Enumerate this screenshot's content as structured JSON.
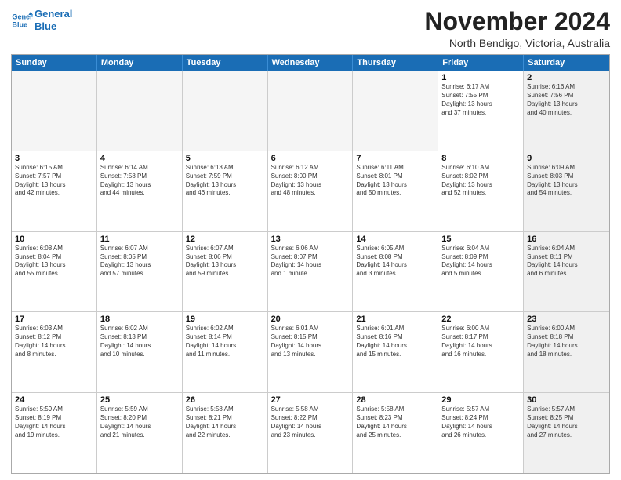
{
  "logo": {
    "line1": "General",
    "line2": "Blue"
  },
  "title": "November 2024",
  "location": "North Bendigo, Victoria, Australia",
  "header_days": [
    "Sunday",
    "Monday",
    "Tuesday",
    "Wednesday",
    "Thursday",
    "Friday",
    "Saturday"
  ],
  "rows": [
    [
      {
        "day": "",
        "text": "",
        "empty": true
      },
      {
        "day": "",
        "text": "",
        "empty": true
      },
      {
        "day": "",
        "text": "",
        "empty": true
      },
      {
        "day": "",
        "text": "",
        "empty": true
      },
      {
        "day": "",
        "text": "",
        "empty": true
      },
      {
        "day": "1",
        "text": "Sunrise: 6:17 AM\nSunset: 7:55 PM\nDaylight: 13 hours\nand 37 minutes.",
        "shaded": false
      },
      {
        "day": "2",
        "text": "Sunrise: 6:16 AM\nSunset: 7:56 PM\nDaylight: 13 hours\nand 40 minutes.",
        "shaded": true
      }
    ],
    [
      {
        "day": "3",
        "text": "Sunrise: 6:15 AM\nSunset: 7:57 PM\nDaylight: 13 hours\nand 42 minutes.",
        "shaded": false
      },
      {
        "day": "4",
        "text": "Sunrise: 6:14 AM\nSunset: 7:58 PM\nDaylight: 13 hours\nand 44 minutes.",
        "shaded": false
      },
      {
        "day": "5",
        "text": "Sunrise: 6:13 AM\nSunset: 7:59 PM\nDaylight: 13 hours\nand 46 minutes.",
        "shaded": false
      },
      {
        "day": "6",
        "text": "Sunrise: 6:12 AM\nSunset: 8:00 PM\nDaylight: 13 hours\nand 48 minutes.",
        "shaded": false
      },
      {
        "day": "7",
        "text": "Sunrise: 6:11 AM\nSunset: 8:01 PM\nDaylight: 13 hours\nand 50 minutes.",
        "shaded": false
      },
      {
        "day": "8",
        "text": "Sunrise: 6:10 AM\nSunset: 8:02 PM\nDaylight: 13 hours\nand 52 minutes.",
        "shaded": false
      },
      {
        "day": "9",
        "text": "Sunrise: 6:09 AM\nSunset: 8:03 PM\nDaylight: 13 hours\nand 54 minutes.",
        "shaded": true
      }
    ],
    [
      {
        "day": "10",
        "text": "Sunrise: 6:08 AM\nSunset: 8:04 PM\nDaylight: 13 hours\nand 55 minutes.",
        "shaded": false
      },
      {
        "day": "11",
        "text": "Sunrise: 6:07 AM\nSunset: 8:05 PM\nDaylight: 13 hours\nand 57 minutes.",
        "shaded": false
      },
      {
        "day": "12",
        "text": "Sunrise: 6:07 AM\nSunset: 8:06 PM\nDaylight: 13 hours\nand 59 minutes.",
        "shaded": false
      },
      {
        "day": "13",
        "text": "Sunrise: 6:06 AM\nSunset: 8:07 PM\nDaylight: 14 hours\nand 1 minute.",
        "shaded": false
      },
      {
        "day": "14",
        "text": "Sunrise: 6:05 AM\nSunset: 8:08 PM\nDaylight: 14 hours\nand 3 minutes.",
        "shaded": false
      },
      {
        "day": "15",
        "text": "Sunrise: 6:04 AM\nSunset: 8:09 PM\nDaylight: 14 hours\nand 5 minutes.",
        "shaded": false
      },
      {
        "day": "16",
        "text": "Sunrise: 6:04 AM\nSunset: 8:11 PM\nDaylight: 14 hours\nand 6 minutes.",
        "shaded": true
      }
    ],
    [
      {
        "day": "17",
        "text": "Sunrise: 6:03 AM\nSunset: 8:12 PM\nDaylight: 14 hours\nand 8 minutes.",
        "shaded": false
      },
      {
        "day": "18",
        "text": "Sunrise: 6:02 AM\nSunset: 8:13 PM\nDaylight: 14 hours\nand 10 minutes.",
        "shaded": false
      },
      {
        "day": "19",
        "text": "Sunrise: 6:02 AM\nSunset: 8:14 PM\nDaylight: 14 hours\nand 11 minutes.",
        "shaded": false
      },
      {
        "day": "20",
        "text": "Sunrise: 6:01 AM\nSunset: 8:15 PM\nDaylight: 14 hours\nand 13 minutes.",
        "shaded": false
      },
      {
        "day": "21",
        "text": "Sunrise: 6:01 AM\nSunset: 8:16 PM\nDaylight: 14 hours\nand 15 minutes.",
        "shaded": false
      },
      {
        "day": "22",
        "text": "Sunrise: 6:00 AM\nSunset: 8:17 PM\nDaylight: 14 hours\nand 16 minutes.",
        "shaded": false
      },
      {
        "day": "23",
        "text": "Sunrise: 6:00 AM\nSunset: 8:18 PM\nDaylight: 14 hours\nand 18 minutes.",
        "shaded": true
      }
    ],
    [
      {
        "day": "24",
        "text": "Sunrise: 5:59 AM\nSunset: 8:19 PM\nDaylight: 14 hours\nand 19 minutes.",
        "shaded": false
      },
      {
        "day": "25",
        "text": "Sunrise: 5:59 AM\nSunset: 8:20 PM\nDaylight: 14 hours\nand 21 minutes.",
        "shaded": false
      },
      {
        "day": "26",
        "text": "Sunrise: 5:58 AM\nSunset: 8:21 PM\nDaylight: 14 hours\nand 22 minutes.",
        "shaded": false
      },
      {
        "day": "27",
        "text": "Sunrise: 5:58 AM\nSunset: 8:22 PM\nDaylight: 14 hours\nand 23 minutes.",
        "shaded": false
      },
      {
        "day": "28",
        "text": "Sunrise: 5:58 AM\nSunset: 8:23 PM\nDaylight: 14 hours\nand 25 minutes.",
        "shaded": false
      },
      {
        "day": "29",
        "text": "Sunrise: 5:57 AM\nSunset: 8:24 PM\nDaylight: 14 hours\nand 26 minutes.",
        "shaded": false
      },
      {
        "day": "30",
        "text": "Sunrise: 5:57 AM\nSunset: 8:25 PM\nDaylight: 14 hours\nand 27 minutes.",
        "shaded": true
      }
    ]
  ]
}
